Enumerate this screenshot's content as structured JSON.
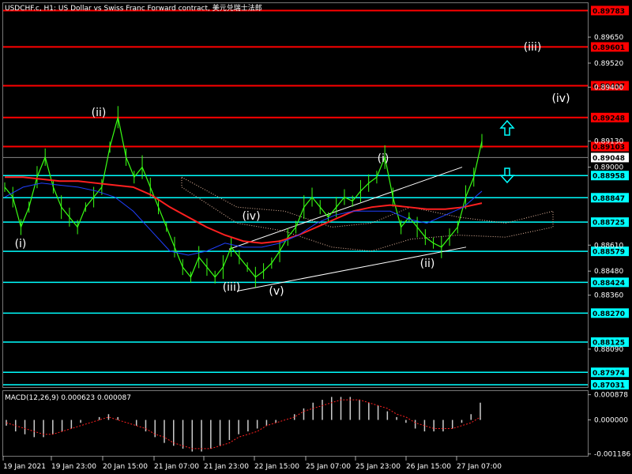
{
  "chart_data": {
    "type": "line",
    "title": "USDCHF.c, H1: US Dollar vs Swiss Franc Forward contract, 美元兑瑞士法郎",
    "symbol": "USDCHF.c",
    "timeframe": "H1",
    "price_ticks": [
      "0.89650",
      "0.89520",
      "0.89400",
      "0.89130",
      "0.89000",
      "0.88610",
      "0.88480",
      "0.88360",
      "0.88090"
    ],
    "price_range": [
      0.879,
      0.8982
    ],
    "current_price": "0.89048",
    "resistance_levels": [
      {
        "value": "0.89783",
        "color": "#ff0000"
      },
      {
        "value": "0.89601",
        "color": "#ff0000"
      },
      {
        "value": "0.89407",
        "color": "#ff0000"
      },
      {
        "value": "0.89248",
        "color": "#ff0000"
      },
      {
        "value": "0.89103",
        "color": "#ff0000"
      }
    ],
    "support_levels": [
      {
        "value": "0.88958",
        "color": "#00ffff"
      },
      {
        "value": "0.88847",
        "color": "#00ffff"
      },
      {
        "value": "0.88725",
        "color": "#00ffff"
      },
      {
        "value": "0.88579",
        "color": "#00ffff"
      },
      {
        "value": "0.88424",
        "color": "#00ffff"
      },
      {
        "value": "0.88270",
        "color": "#00ffff"
      },
      {
        "value": "0.88125",
        "color": "#00ffff"
      },
      {
        "value": "0.87974",
        "color": "#00ffff"
      },
      {
        "value": "0.87031",
        "color": "#00ffff"
      }
    ],
    "x_tick_labels": [
      "19 Jan 2021",
      "19 Jan 23:00",
      "20 Jan 15:00",
      "21 Jan 07:00",
      "21 Jan 23:00",
      "22 Jan 15:00",
      "25 Jan 07:00",
      "25 Jan 23:00",
      "26 Jan 15:00",
      "27 Jan 07:00"
    ],
    "wave_labels": [
      "(i)",
      "(ii)",
      "(iii)",
      "(iv)",
      "(v)",
      "(i)",
      "(ii)",
      "(iii)",
      "(iv)"
    ],
    "price_series": {
      "name": "",
      "color": "#39ff14",
      "values": [
        0.889,
        0.8885,
        0.887,
        0.888,
        0.8895,
        0.8905,
        0.889,
        0.888,
        0.8875,
        0.887,
        0.888,
        0.8885,
        0.889,
        0.891,
        0.8925,
        0.8905,
        0.8895,
        0.89,
        0.889,
        0.888,
        0.887,
        0.886,
        0.885,
        0.8845,
        0.8855,
        0.885,
        0.8845,
        0.885,
        0.886,
        0.8855,
        0.885,
        0.8845,
        0.8848,
        0.8852,
        0.8858,
        0.8865,
        0.887,
        0.888,
        0.8885,
        0.888,
        0.8875,
        0.888,
        0.8885,
        0.8883,
        0.8888,
        0.8892,
        0.8895,
        0.8905,
        0.8885,
        0.887,
        0.8875,
        0.887,
        0.8865,
        0.8862,
        0.886,
        0.8865,
        0.887,
        0.8885,
        0.8895,
        0.8913
      ]
    },
    "ma_series": [
      {
        "name": "",
        "color": "#ff2020",
        "values": [
          0.8895,
          0.8895,
          0.8894,
          0.8893,
          0.8893,
          0.8892,
          0.8891,
          0.889,
          0.8886,
          0.888,
          0.8875,
          0.887,
          0.8866,
          0.8863,
          0.8862,
          0.8863,
          0.8866,
          0.887,
          0.8874,
          0.8878,
          0.888,
          0.8881,
          0.888,
          0.8879,
          0.8879,
          0.888,
          0.8882
        ]
      },
      {
        "name": "",
        "color": "#2040ff",
        "values": [
          0.8885,
          0.889,
          0.8892,
          0.8891,
          0.889,
          0.8888,
          0.8885,
          0.8878,
          0.8868,
          0.8858,
          0.8856,
          0.8858,
          0.8862,
          0.886,
          0.886,
          0.8862,
          0.8866,
          0.8872,
          0.8876,
          0.8878,
          0.8878,
          0.8878,
          0.8874,
          0.8872,
          0.8876,
          0.888,
          0.8888
        ]
      }
    ],
    "macd": {
      "label": "MACD(12,26,9) 0.000623 0.000087",
      "ticks": [
        "0.000878",
        "0.000000",
        "-0.001186"
      ],
      "range": [
        -0.00125,
        0.00095
      ],
      "histogram": [
        -0.0002,
        -0.0004,
        -0.0005,
        -0.0006,
        -0.0006,
        -0.0005,
        -0.0004,
        -0.0003,
        -0.0001,
        0.0,
        0.0001,
        0.0002,
        0.0001,
        0.0,
        -0.0002,
        -0.0004,
        -0.0006,
        -0.0008,
        -0.0009,
        -0.001,
        -0.0011,
        -0.0011,
        -0.001,
        -0.0009,
        -0.0007,
        -0.0005,
        -0.0004,
        -0.0003,
        -0.0002,
        -0.0001,
        0.0,
        0.0002,
        0.0004,
        0.0006,
        0.0007,
        0.0008,
        0.0008,
        0.0008,
        0.0007,
        0.0006,
        0.0005,
        0.0003,
        0.0001,
        -0.0001,
        -0.0003,
        -0.0004,
        -0.0004,
        -0.0004,
        -0.0003,
        -0.0001,
        0.0002,
        0.0006
      ],
      "signal": [
        -0.0001,
        -0.0002,
        -0.0003,
        -0.0004,
        -0.0005,
        -0.0005,
        -0.0004,
        -0.0003,
        -0.0002,
        -0.0001,
        0.0,
        0.0001,
        0.0,
        -0.0001,
        -0.0002,
        -0.0003,
        -0.0005,
        -0.0006,
        -0.0008,
        -0.0009,
        -0.001,
        -0.001,
        -0.001,
        -0.0009,
        -0.0008,
        -0.0006,
        -0.0005,
        -0.0004,
        -0.0002,
        -0.0001,
        0.0,
        0.0001,
        0.0003,
        0.0004,
        0.0005,
        0.0006,
        0.0007,
        0.0007,
        0.0007,
        0.0006,
        0.0005,
        0.0004,
        0.0002,
        0.0001,
        -0.0001,
        -0.0002,
        -0.0003,
        -0.0003,
        -0.0003,
        -0.0002,
        -0.0001,
        0.0001
      ]
    }
  }
}
